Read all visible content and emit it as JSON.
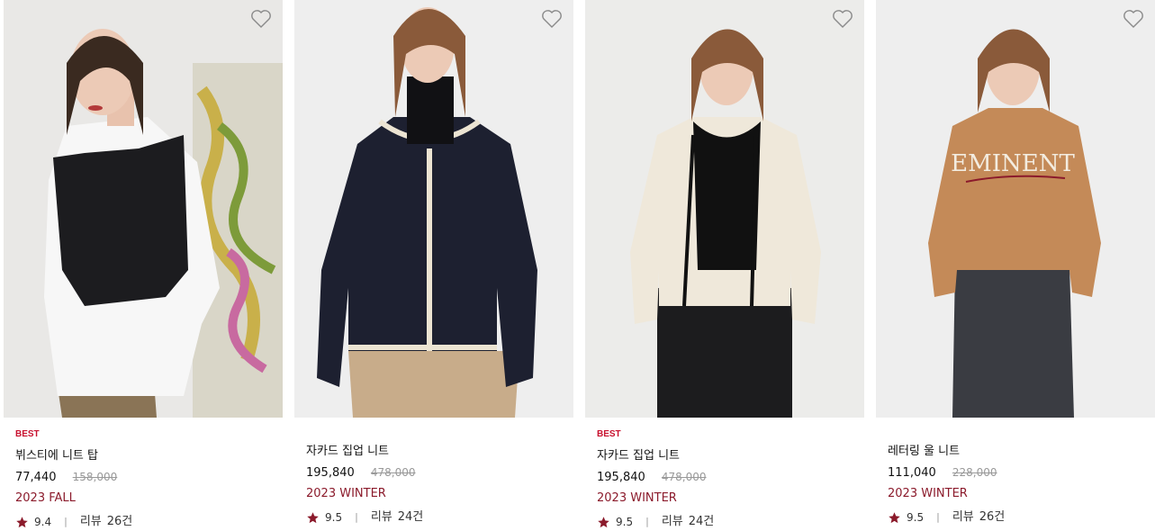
{
  "products": [
    {
      "badge": "BEST",
      "name": "뷔스티에 니트 탑",
      "price": "77,440",
      "original_price": "158,000",
      "season": "2023 FALL",
      "rating": "9.4",
      "review_label": "리뷰",
      "review_count": "26건",
      "wish_icon": "heart-outline-icon"
    },
    {
      "badge": "",
      "name": "자카드 집업 니트",
      "price": "195,840",
      "original_price": "478,000",
      "season": "2023 WINTER",
      "rating": "9.5",
      "review_label": "리뷰",
      "review_count": "24건",
      "wish_icon": "heart-outline-icon"
    },
    {
      "badge": "BEST",
      "name": "자카드 집업 니트",
      "price": "195,840",
      "original_price": "478,000",
      "season": "2023 WINTER",
      "rating": "9.5",
      "review_label": "리뷰",
      "review_count": "24건",
      "wish_icon": "heart-outline-icon"
    },
    {
      "badge": "",
      "name": "레터링 울 니트",
      "price": "111,040",
      "original_price": "228,000",
      "season": "2023 WINTER",
      "rating": "9.5",
      "review_label": "리뷰",
      "review_count": "26건",
      "wish_icon": "heart-outline-icon"
    }
  ],
  "sweater_lettering": "EMINENT",
  "colors": {
    "badge": "#c8102e",
    "season": "#8b1a2b",
    "star": "#8b1a2b",
    "original_price": "#999999"
  }
}
